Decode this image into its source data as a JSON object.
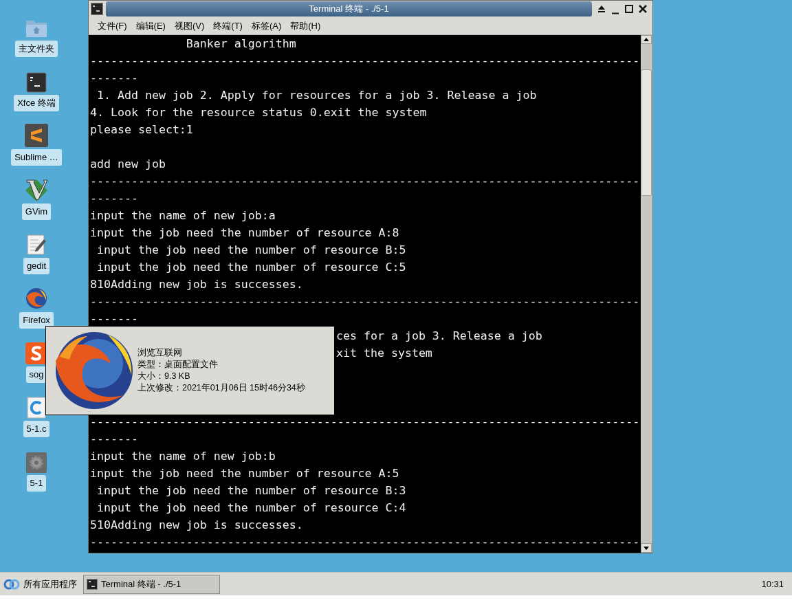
{
  "desktop_icons": [
    {
      "label": "主文件夹",
      "kind": "folder"
    },
    {
      "label": "Xfce 终端",
      "kind": "terminal"
    },
    {
      "label": "Sublime …",
      "kind": "sublime"
    },
    {
      "label": "GVim",
      "kind": "vim"
    },
    {
      "label": "gedit",
      "kind": "gedit"
    },
    {
      "label": "Firefox",
      "kind": "firefox"
    },
    {
      "label": "sog",
      "kind": "sogou"
    },
    {
      "label": "5-1.c",
      "kind": "csource"
    },
    {
      "label": "5-1",
      "kind": "executable"
    }
  ],
  "window": {
    "title": "Terminal 终端 - ./5-1",
    "menu": [
      "文件(F)",
      "编辑(E)",
      "视图(V)",
      "终端(T)",
      "标签(A)",
      "帮助(H)"
    ],
    "terminal_lines": [
      {
        "kind": "line",
        "text": "              Banker algorithm"
      },
      {
        "kind": "line",
        "text": "--------------------------------------------------------------------------------"
      },
      {
        "kind": "line",
        "text": "-------"
      },
      {
        "kind": "line",
        "text": " 1. Add new job 2. Apply for resources for a job 3. Release a job"
      },
      {
        "kind": "line",
        "text": "4. Look for the resource status 0.exit the system"
      },
      {
        "kind": "line",
        "text": "please select:1"
      },
      {
        "kind": "blank"
      },
      {
        "kind": "line",
        "text": "add new job"
      },
      {
        "kind": "line",
        "text": "--------------------------------------------------------------------------------"
      },
      {
        "kind": "line",
        "text": "-------"
      },
      {
        "kind": "line",
        "text": "input the name of new job:a"
      },
      {
        "kind": "line",
        "text": "input the job need the number of resource A:8"
      },
      {
        "kind": "line",
        "text": " input the job need the number of resource B:5"
      },
      {
        "kind": "line",
        "text": " input the job need the number of resource C:5"
      },
      {
        "kind": "line",
        "text": "810Adding new job is successes."
      },
      {
        "kind": "line",
        "text": "--------------------------------------------------------------------------------"
      },
      {
        "kind": "line",
        "text": "-------"
      },
      {
        "kind": "fragment",
        "text": "ces for a job 3. Release a job"
      },
      {
        "kind": "fragment",
        "text": "xit the system"
      },
      {
        "kind": "blank"
      },
      {
        "kind": "blank"
      },
      {
        "kind": "blank"
      },
      {
        "kind": "line",
        "text": "--------------------------------------------------------------------------------"
      },
      {
        "kind": "line",
        "text": "-------"
      },
      {
        "kind": "line",
        "text": "input the name of new job:b"
      },
      {
        "kind": "line",
        "text": "input the job need the number of resource A:5"
      },
      {
        "kind": "line",
        "text": " input the job need the number of resource B:3"
      },
      {
        "kind": "line",
        "text": " input the job need the number of resource C:4"
      },
      {
        "kind": "line",
        "text": "510Adding new job is successes."
      },
      {
        "kind": "line",
        "text": "--------------------------------------------------------------------------------"
      }
    ]
  },
  "tooltip": {
    "lines": [
      "浏览互联网",
      "类型：桌面配置文件",
      "大小：9.3 KB",
      "上次修改：2021年01月06日 15时46分34秒"
    ]
  },
  "taskbar": {
    "start_label": "所有应用程序",
    "tasks": [
      {
        "label": "Terminal 终端 - ./5-1",
        "selected": true
      }
    ],
    "clock": "10:31"
  }
}
